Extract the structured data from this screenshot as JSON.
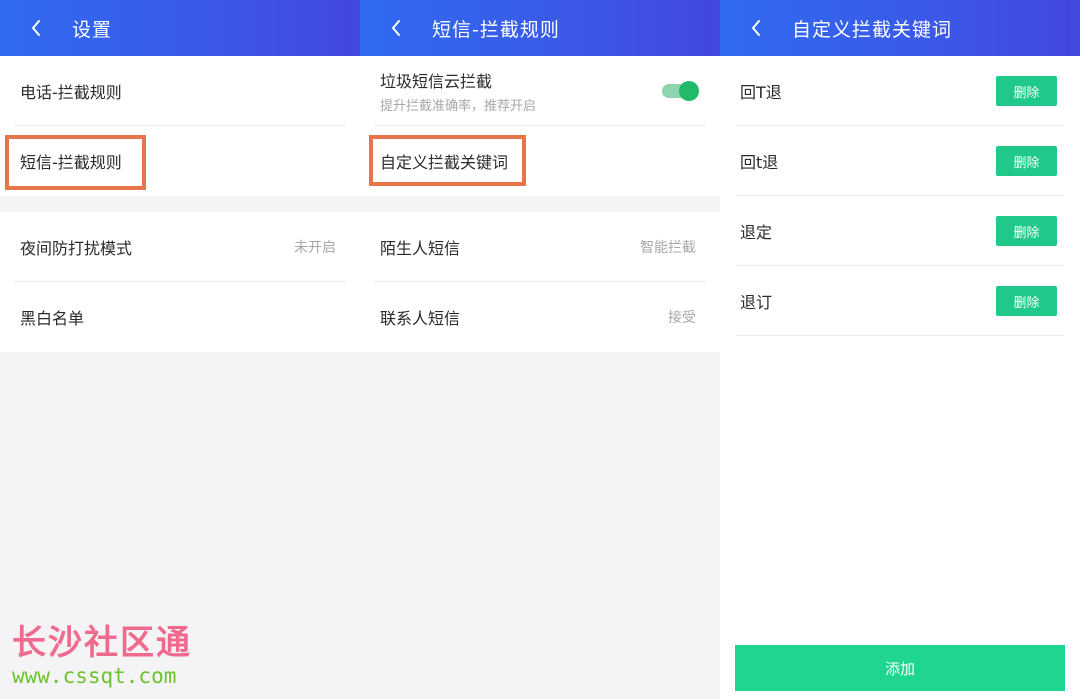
{
  "panel1": {
    "title": "设置",
    "items": [
      {
        "label": "电话-拦截规则"
      },
      {
        "label": "短信-拦截规则"
      }
    ],
    "items2": [
      {
        "label": "夜间防打扰模式",
        "value": "未开启"
      },
      {
        "label": "黑白名单"
      }
    ]
  },
  "panel2": {
    "title": "短信-拦截规则",
    "cloud": {
      "label": "垃圾短信云拦截",
      "sub": "提升拦截准确率，推荐开启",
      "enabled": true
    },
    "custom_keywords": {
      "label": "自定义拦截关键词"
    },
    "items2": [
      {
        "label": "陌生人短信",
        "value": "智能拦截"
      },
      {
        "label": "联系人短信",
        "value": "接受"
      }
    ]
  },
  "panel3": {
    "title": "自定义拦截关键词",
    "keywords": [
      {
        "label": "回T退",
        "delete": "删除"
      },
      {
        "label": "回t退",
        "delete": "删除"
      },
      {
        "label": "退定",
        "delete": "删除"
      },
      {
        "label": "退订",
        "delete": "删除"
      }
    ],
    "add_label": "添加"
  },
  "watermark": {
    "title": "长沙社区通",
    "url": "www.cssqt.com"
  },
  "colors": {
    "header_start": "#2f6bf0",
    "header_end": "#4347de",
    "highlight": "#e8744a",
    "toggle_on": "#21b96a",
    "delete_button": "#20c98a",
    "add_button": "#20d590"
  },
  "icons": {
    "back": "chevron-left-icon"
  }
}
